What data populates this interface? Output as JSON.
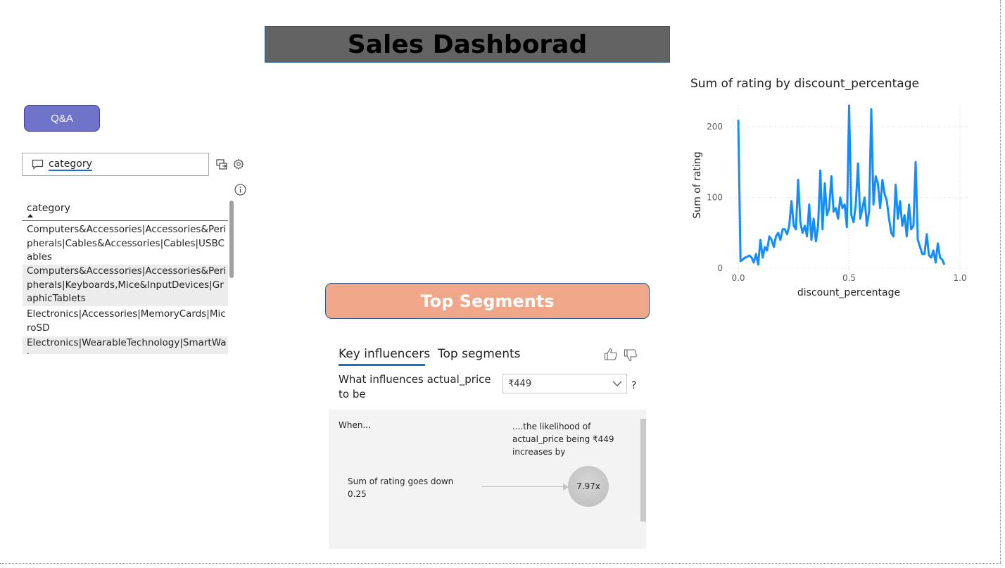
{
  "title": "Sales Dashborad",
  "qa": {
    "button_label": "Q&A",
    "input_value": "category",
    "table": {
      "header": "category",
      "rows": [
        "Computers&Accessories|Accessories&Peripherals|Cables&Accessories|Cables|USBCables",
        "Computers&Accessories|Accessories&Peripherals|Keyboards,Mice&InputDevices|GraphicTablets",
        "Electronics|Accessories|MemoryCards|MicroSD",
        "Electronics|WearableTechnology|SmartWat"
      ]
    }
  },
  "segments_banner": "Top Segments",
  "key_influencers": {
    "tabs": [
      "Key influencers",
      "Top segments"
    ],
    "active_tab": "Key influencers",
    "question": "What influences actual_price to be",
    "selected_value": "₹449",
    "help": "?",
    "when_label": "When...",
    "likelihood_text": "....the likelihood of actual_price being ₹449 increases by",
    "factor_text": "Sum of rating goes down 0.25",
    "multiplier": "7.97x"
  },
  "chart_data": {
    "type": "line",
    "title": "Sum of rating by discount_percentage",
    "xlabel": "discount_percentage",
    "ylabel": "Sum of rating",
    "xlim": [
      0,
      1.0
    ],
    "ylim": [
      0,
      230
    ],
    "xticks": [
      "0.0",
      "0.5",
      "1.0"
    ],
    "yticks": [
      "0",
      "100",
      "200"
    ],
    "grid": true,
    "color": "#118dff",
    "x": [
      0.0,
      0.01,
      0.02,
      0.03,
      0.04,
      0.05,
      0.06,
      0.07,
      0.08,
      0.09,
      0.1,
      0.11,
      0.12,
      0.13,
      0.14,
      0.15,
      0.16,
      0.17,
      0.18,
      0.19,
      0.2,
      0.21,
      0.22,
      0.23,
      0.24,
      0.25,
      0.26,
      0.27,
      0.28,
      0.29,
      0.3,
      0.31,
      0.32,
      0.33,
      0.34,
      0.35,
      0.36,
      0.37,
      0.38,
      0.39,
      0.4,
      0.41,
      0.42,
      0.43,
      0.44,
      0.45,
      0.46,
      0.47,
      0.48,
      0.49,
      0.5,
      0.51,
      0.52,
      0.53,
      0.54,
      0.55,
      0.56,
      0.57,
      0.58,
      0.59,
      0.6,
      0.61,
      0.62,
      0.63,
      0.64,
      0.65,
      0.66,
      0.67,
      0.68,
      0.69,
      0.7,
      0.71,
      0.72,
      0.73,
      0.74,
      0.75,
      0.76,
      0.77,
      0.78,
      0.79,
      0.8,
      0.81,
      0.82,
      0.83,
      0.84,
      0.85,
      0.86,
      0.87,
      0.88,
      0.89,
      0.9,
      0.91,
      0.92,
      0.93
    ],
    "values": [
      210,
      10,
      12,
      15,
      16,
      18,
      15,
      8,
      20,
      5,
      40,
      15,
      30,
      25,
      45,
      40,
      30,
      45,
      50,
      40,
      55,
      55,
      48,
      60,
      95,
      60,
      55,
      125,
      65,
      50,
      60,
      45,
      90,
      40,
      70,
      38,
      60,
      138,
      55,
      120,
      75,
      85,
      130,
      80,
      85,
      70,
      100,
      85,
      90,
      58,
      230,
      75,
      65,
      90,
      148,
      70,
      85,
      100,
      60,
      80,
      225,
      90,
      130,
      120,
      85,
      125,
      105,
      95,
      70,
      50,
      45,
      118,
      70,
      95,
      60,
      75,
      45,
      90,
      55,
      60,
      150,
      40,
      30,
      20,
      20,
      48,
      18,
      15,
      25,
      8,
      35,
      15,
      12,
      5
    ]
  }
}
